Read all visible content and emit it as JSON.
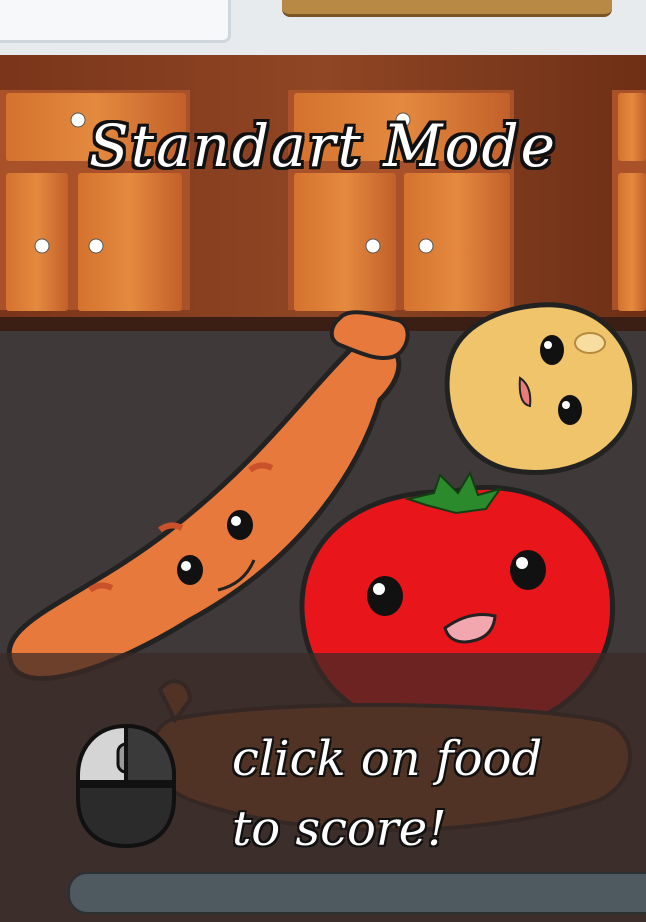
{
  "game": {
    "mode_title": "Standart Mode",
    "hint_line1": "click on food",
    "hint_line2": "to score!"
  },
  "colors": {
    "wood_cabinet": "#c96a2b",
    "counter": "#3f3a39",
    "tomato": "#e8151b",
    "sausage": "#e8793c",
    "potato": "#f0c46a"
  },
  "icons": [
    "mouse-icon"
  ],
  "foods": [
    "sausage",
    "potato",
    "tomato"
  ]
}
